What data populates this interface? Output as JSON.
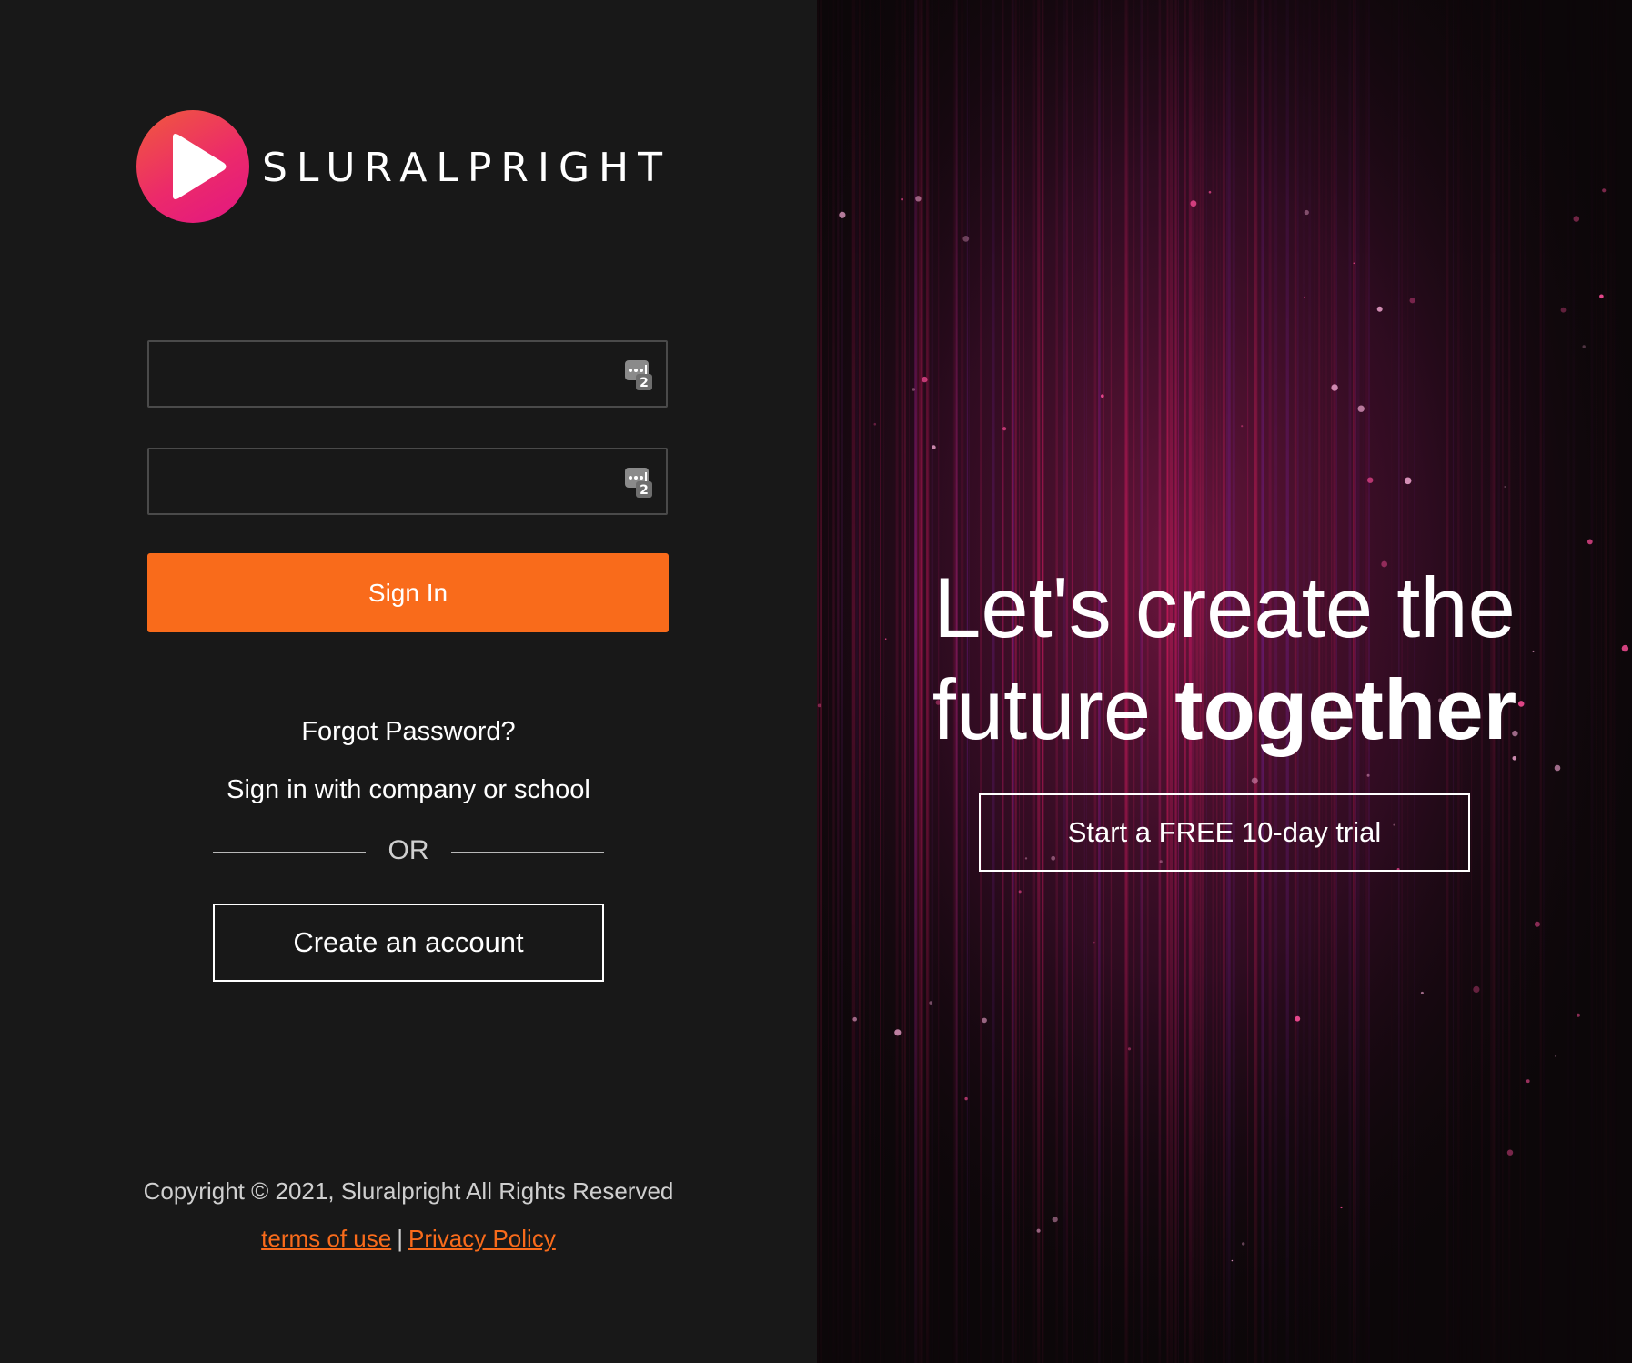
{
  "brand": {
    "name": "SLURALPRIGHT",
    "logo_icon": "play-icon",
    "colors": {
      "logo_gradient_start": "#f05a3c",
      "logo_gradient_end": "#e21683",
      "accent": "#f96b1b",
      "background": "#181818"
    }
  },
  "login_form": {
    "username": {
      "value": "",
      "placeholder": "",
      "icon": "password-manager-icon"
    },
    "password": {
      "value": "",
      "placeholder": "",
      "icon": "password-manager-icon"
    },
    "sign_in_label": "Sign In",
    "forgot_password_label": "Forgot Password?",
    "company_sign_in_label": "Sign in with company or school",
    "divider_label": "OR",
    "create_account_label": "Create an account"
  },
  "footer": {
    "copyright": "Copyright © 2021, Sluralpright All Rights Reserved",
    "terms_label": "terms of use",
    "separator": "|",
    "privacy_label": "Privacy Policy"
  },
  "hero": {
    "headline_line1": "Let's create the",
    "headline_line2_normal": "future ",
    "headline_line2_bold": "together",
    "trial_button_label": "Start a FREE 10-day trial"
  }
}
